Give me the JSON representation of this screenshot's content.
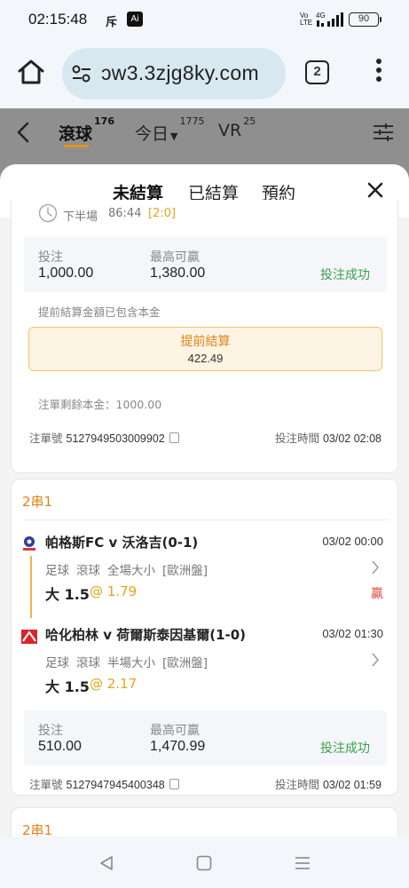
{
  "status_bar": {
    "time": "02:15:48",
    "icon_label": "斥",
    "ai_label": "Ai",
    "volte": "Vo LTE",
    "network": "4G",
    "battery": "90"
  },
  "browser": {
    "url": "ɔw3.3zjg8ky.com",
    "tab_count": "2"
  },
  "game_tabs": [
    {
      "label": "滾球",
      "count": "176"
    },
    {
      "label": "今日",
      "count": "1775"
    },
    {
      "label": "VR",
      "count": "25"
    }
  ],
  "sheet": {
    "tabs": [
      "未結算",
      "已結算",
      "預約"
    ],
    "active_tab": "未結算"
  },
  "card1": {
    "period": "下半場",
    "minute": "86:44",
    "score": "[2:0]",
    "stake_label": "投注",
    "stake": "1,000.00",
    "maxwin_label": "最高可贏",
    "maxwin": "1,380.00",
    "status": "投注成功",
    "note1": "提前結算金額已包含本金",
    "cashout_label": "提前結算",
    "cashout_value": "422.49",
    "note2": "注單剩餘本金：1000.00",
    "order_label": "注單號",
    "order_no": "5127949503009902",
    "bet_time_label": "投注時間",
    "bet_time": "03/02 02:08"
  },
  "card2": {
    "combo": "2串1",
    "legs": [
      {
        "match": "帕格斯FC v 沃洛吉(0-1)",
        "time": "03/02 00:00",
        "sport": "足球",
        "type": "滾球",
        "market": "全場大小",
        "handicap": "[歐洲盤]",
        "pick": "大 1.5",
        "odds": "@ 1.79",
        "result": "贏"
      },
      {
        "match": "哈化柏林 v 荷爾斯泰因基爾(1-0)",
        "time": "03/02 01:30",
        "sport": "足球",
        "type": "滾球",
        "market": "半場大小",
        "handicap": "[歐洲盤]",
        "pick": "大 1.5",
        "odds": "@ 2.17",
        "result": ""
      }
    ],
    "stake_label": "投注",
    "stake": "510.00",
    "maxwin_label": "最高可贏",
    "maxwin": "1,470.99",
    "status": "投注成功",
    "order_label": "注單號",
    "order_no": "5127947945400348",
    "bet_time_label": "投注時間",
    "bet_time": "03/02 01:59"
  },
  "card3": {
    "combo": "2串1"
  },
  "colors": {
    "accent": "#e2931b",
    "success": "#3ba24a",
    "win": "#e0463a",
    "odds": "#e2a51b"
  }
}
